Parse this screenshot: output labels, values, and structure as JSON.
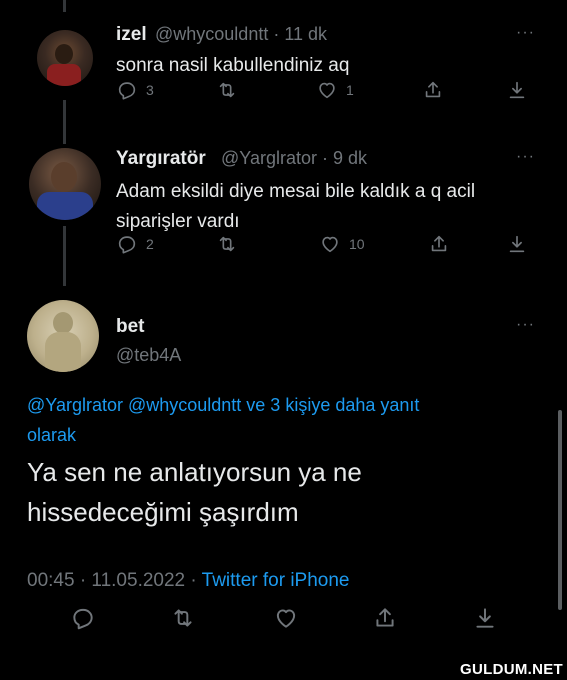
{
  "tweets": [
    {
      "name": "izel",
      "handle": "@whycouldntt",
      "sep": "·",
      "time": "11 dk",
      "text": "sonra nasil kabullendiniz aq",
      "reply_count": "3",
      "retweet_count": "",
      "like_count": "1"
    },
    {
      "name": "Yargıratör",
      "handle": "@Yarglrator",
      "sep": "·",
      "time": "9 dk",
      "text_line1": "Adam eksildi diye mesai bile kaldık a q acil",
      "text_line2": "siparişler vardı",
      "reply_count": "2",
      "retweet_count": "",
      "like_count": "10"
    }
  ],
  "main": {
    "name": "bet",
    "handle": "@teb4A",
    "reply_to_line1": "@Yarglrator @whycouldntt ve 3 kişiye daha yanıt",
    "reply_to_line2": "olarak",
    "text_line1": "Ya sen ne anlatıyorsun ya ne",
    "text_line2": "hissedeceğimi şaşırdım",
    "time": "00:45 · 11.05.2022 · ",
    "source": "Twitter for iPhone"
  },
  "more_label": "···",
  "watermark": "GULDUM.NET",
  "colors": {
    "background": "#000000",
    "text": "#e7e9ea",
    "muted": "#71767b",
    "accent": "#1d9bf0"
  }
}
